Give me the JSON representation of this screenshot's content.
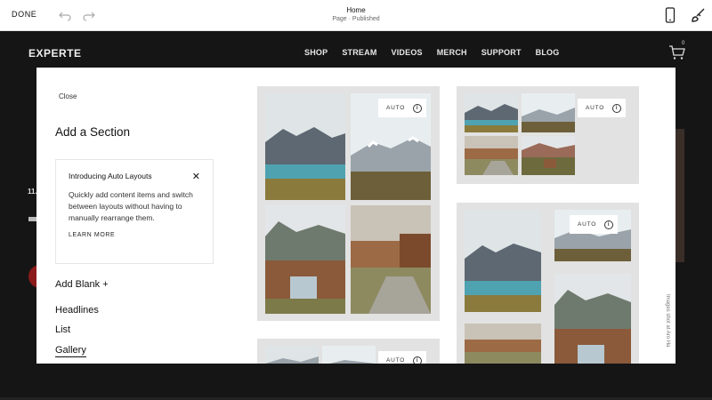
{
  "toolbar": {
    "done_label": "DONE",
    "page_title": "Home",
    "page_status": "Page · Published"
  },
  "site": {
    "logo": "EXPERTE",
    "nav": [
      "SHOP",
      "STREAM",
      "VIDEOS",
      "MERCH",
      "SUPPORT",
      "BLOG"
    ],
    "cart_count": "0",
    "bg_text": "11."
  },
  "modal": {
    "close_label": "Close",
    "title": "Add a Section",
    "notice": {
      "title": "Introducing Auto Layouts",
      "body": "Quickly add content items and switch between layouts without having to manually rearrange them.",
      "link": "LEARN MORE"
    },
    "add_blank": "Add Blank +",
    "categories": [
      "Headlines",
      "List",
      "Gallery"
    ],
    "active_category": "Gallery",
    "auto_label": "AUTO",
    "credit": "Images shot at Aro Ha"
  },
  "colors": {
    "card_bg": "#e2e2e2",
    "site_bg": "#151515",
    "lake": "#4fa3b0",
    "mountain": "#5d6872",
    "grass": "#8a7a3c",
    "cabin": "#8a5a3a"
  }
}
